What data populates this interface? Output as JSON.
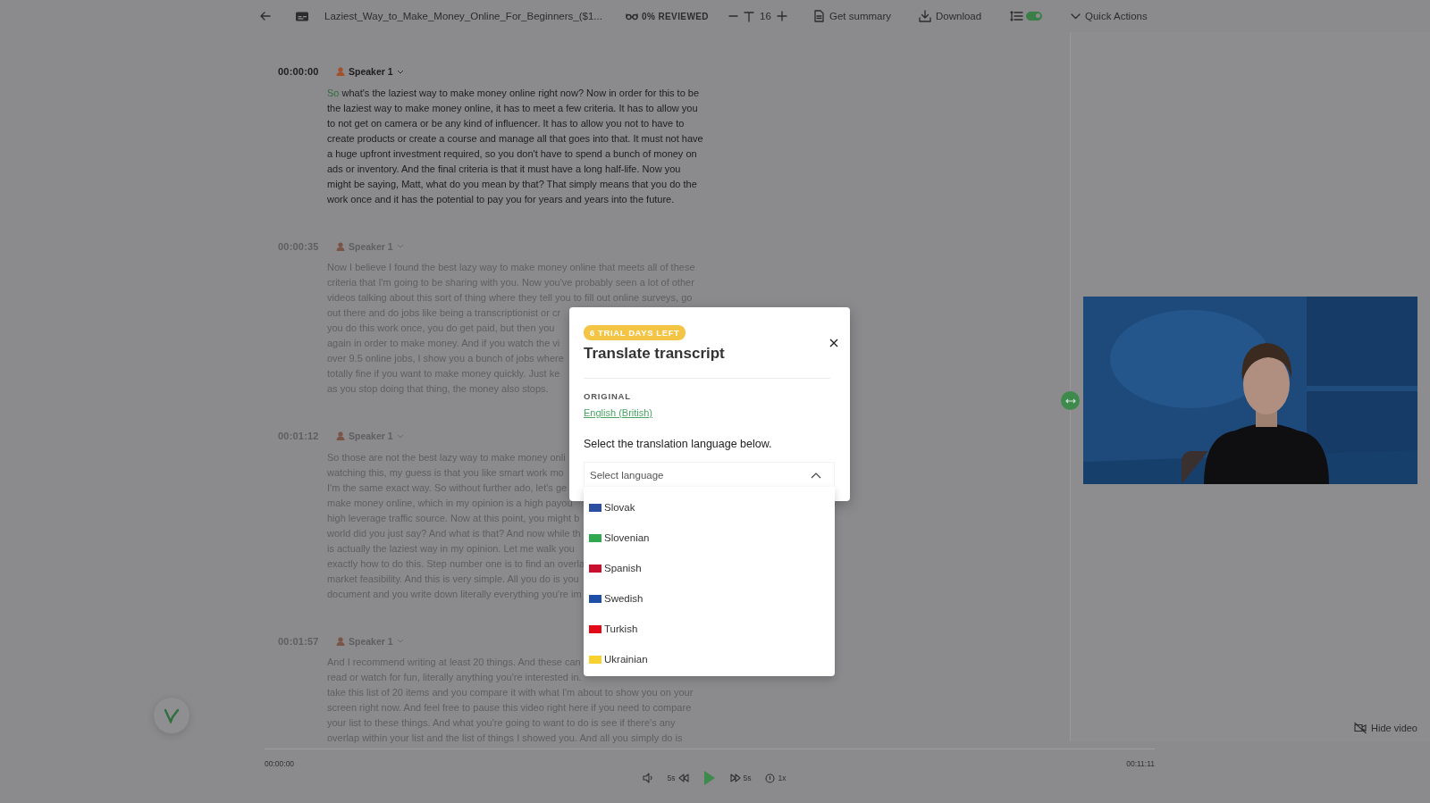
{
  "toolbar": {
    "file_name": "Laziest_Way_to_Make_Money_Online_For_Beginners_($1...",
    "review_status": "0% REVIEWED",
    "font_size": "16",
    "summary": "Get summary",
    "download": "Download",
    "toggle_on": true,
    "quick_actions": "Quick Actions"
  },
  "transcript": [
    {
      "time": "00:00:00",
      "speaker": "Speaker 1",
      "dimmed": false,
      "current_word": "So",
      "lines": [
        "what's the laziest way to make money online right now? Now in order for this to be",
        "the laziest way to make money online, it has to meet a few criteria. It has to allow you",
        "to not get on camera or be any kind of influencer. It has to allow you not to have to",
        "create products or create a course and manage all that goes into that. It must not have",
        "a huge upfront investment required, so you don't have to spend a bunch of money on",
        "ads or inventory. And the final criteria is that it must have a long half-life. Now you",
        "might be saying, Matt, what do you mean by that? That simply means that you do the",
        "work once and it has the potential to pay you for years and years into the future."
      ]
    },
    {
      "time": "00:00:35",
      "speaker": "Speaker 1",
      "dimmed": true,
      "lines": [
        "Now I believe I found the best lazy way to make money online that meets all of these",
        "criteria that I'm going to be sharing with you. Now you've probably seen a lot of other",
        "videos talking about this sort of thing where they tell you to fill out online surveys, go",
        "out there and do jobs like being a transcriptionist or cr",
        "you do this work once, you do get paid, but then you",
        "again in order to make money. And if you watch the vi",
        "over 9.5 online jobs, I show you a bunch of jobs where",
        "totally fine if you want to make money quickly. Just ke",
        "as you stop doing that thing, the money also stops."
      ]
    },
    {
      "time": "00:01:12",
      "speaker": "Speaker 1",
      "dimmed": true,
      "lines": [
        "So those are not the best lazy way to make money onli",
        "watching this, my guess is that you like smart work mo",
        "I'm the same exact way. So without further ado, let's ge",
        "make money online, which in my opinion is a high payou",
        "high leverage traffic source. Now at this point, you might b",
        "world did you just say? And what is that? And now while th",
        "is actually the laziest way in my opinion. Let me walk you",
        "exactly how to do this. Step number one is to find an overla",
        "market feasibility. And this is very simple. All you do is you",
        "document and you write down literally everything you're im"
      ]
    },
    {
      "time": "00:01:57",
      "speaker": "Speaker 1",
      "dimmed": true,
      "lines": [
        "And I recommend writing at least 20 things. And these can",
        "read or watch for fun, literally anything you're interested in.",
        "take this list of 20 items and you compare it with what I'm about to show you on your",
        "screen right now. And feel free to pause this video right here if you need to compare",
        "your list to these things. And what you're going to want to do is see if there's any",
        "overlap within your list and the list of things I showed you. And all you simply do is"
      ]
    }
  ],
  "video": {
    "hide_button": "Hide video"
  },
  "player": {
    "current_time": "00:00:00",
    "duration": "00:11:11",
    "level": 0,
    "rewind": "5s",
    "forward": "5s",
    "speed": "1x"
  },
  "modal": {
    "badge": "6 TRIAL DAYS LEFT",
    "title": "Translate transcript",
    "original_label": "ORIGINAL",
    "original_language": "English (British)",
    "instruction": "Select the translation language below.",
    "select": {
      "placeholder": "Select language",
      "expanded": true
    },
    "languages": [
      {
        "name": "Slovak",
        "color": "#2b4ea0"
      },
      {
        "name": "Slovenian",
        "color": "#2fa84f"
      },
      {
        "name": "Spanish",
        "color": "#c8102e"
      },
      {
        "name": "Swedish",
        "color": "#1e4fa8"
      },
      {
        "name": "Turkish",
        "color": "#e30a17"
      },
      {
        "name": "Ukrainian",
        "color": "#f8d12f"
      }
    ]
  }
}
